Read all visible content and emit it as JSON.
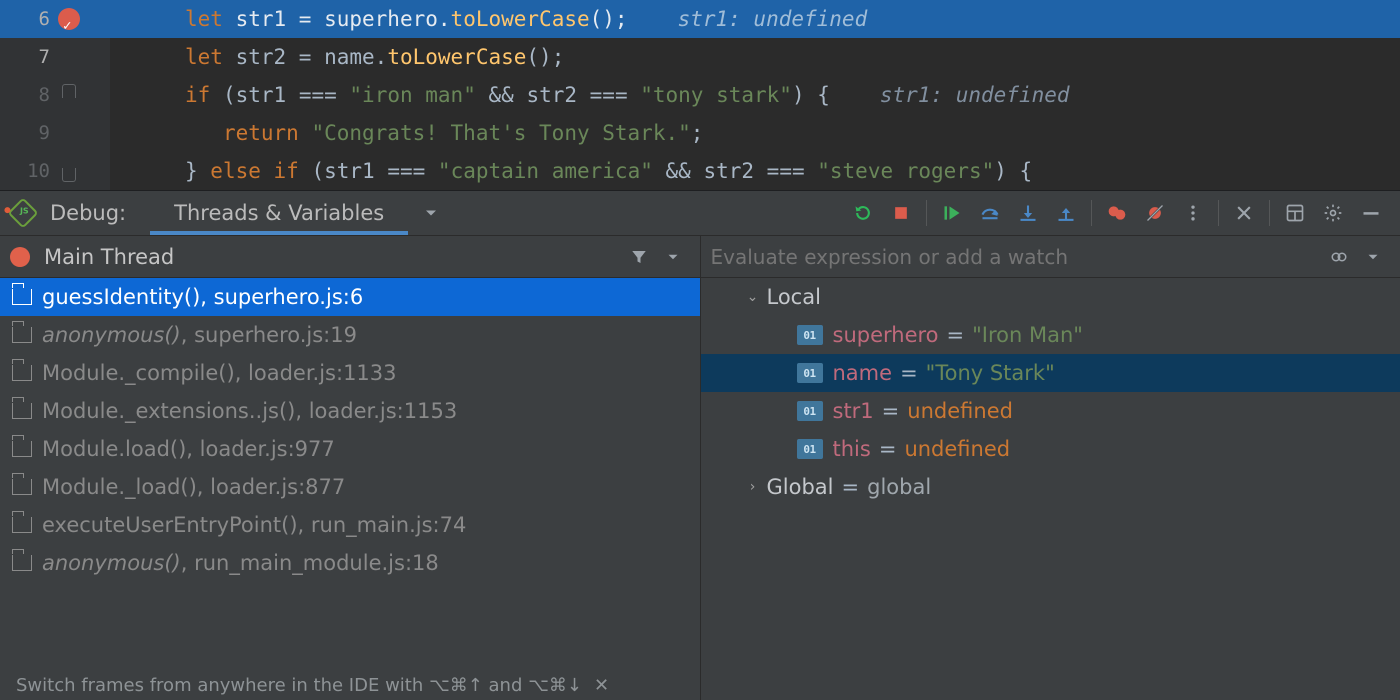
{
  "editor": {
    "lines": [
      {
        "num": 6,
        "breakpoint_hit": true,
        "current": true,
        "tokens": [
          [
            "kw",
            "let"
          ],
          [
            "",
            ""
          ],
          [
            "",
            " str1 "
          ],
          [
            "punct",
            "= "
          ],
          [
            "",
            "superhero"
          ],
          [
            "punct",
            "."
          ],
          [
            "fn",
            "toLowerCase"
          ],
          [
            "punct",
            "();"
          ]
        ],
        "hint": "str1: undefined"
      },
      {
        "num": 7,
        "current_num": true,
        "tokens": [
          [
            "kw",
            "let"
          ],
          [
            "",
            " str2 "
          ],
          [
            "punct",
            "= "
          ],
          [
            "",
            "name"
          ],
          [
            "punct",
            "."
          ],
          [
            "fn",
            "toLowerCase"
          ],
          [
            "punct",
            "();"
          ]
        ]
      },
      {
        "num": 8,
        "fold_top": true,
        "tokens": [
          [
            "kw",
            "if"
          ],
          [
            "",
            " "
          ],
          [
            "punct",
            "("
          ],
          [
            "",
            "str1 "
          ],
          [
            "punct",
            "=== "
          ],
          [
            "str",
            "\"iron man\""
          ],
          [
            "",
            " "
          ],
          [
            "punct",
            "&& "
          ],
          [
            "",
            "str2 "
          ],
          [
            "punct",
            "=== "
          ],
          [
            "str",
            "\"tony stark\""
          ],
          [
            "punct",
            ") {"
          ]
        ],
        "hint": "str1: undefined"
      },
      {
        "num": 9,
        "tokens": [
          [
            "",
            "   "
          ],
          [
            "kw",
            "return"
          ],
          [
            "",
            " "
          ],
          [
            "str",
            "\"Congrats! That's Tony Stark.\""
          ],
          [
            "punct",
            ";"
          ]
        ]
      },
      {
        "num": 10,
        "fold_bot": true,
        "tokens": [
          [
            "punct",
            "} "
          ],
          [
            "kw",
            "else if"
          ],
          [
            "",
            " "
          ],
          [
            "punct",
            "("
          ],
          [
            "",
            "str1 "
          ],
          [
            "punct",
            "=== "
          ],
          [
            "str",
            "\"captain america\""
          ],
          [
            "",
            " "
          ],
          [
            "punct",
            "&& "
          ],
          [
            "",
            "str2 "
          ],
          [
            "punct",
            "=== "
          ],
          [
            "str",
            "\"steve rogers\""
          ],
          [
            "punct",
            ") {"
          ]
        ]
      }
    ]
  },
  "debug_toolbar": {
    "label": "Debug:",
    "tab": "Threads & Variables"
  },
  "frames": {
    "title": "Main Thread",
    "items": [
      {
        "text": "guessIdentity(), superhero.js:6",
        "selected": true
      },
      {
        "text_italic": "anonymous()",
        "suffix": ", superhero.js:19"
      },
      {
        "text": "Module._compile(), loader.js:1133"
      },
      {
        "text": "Module._extensions..js(), loader.js:1153"
      },
      {
        "text": "Module.load(), loader.js:977"
      },
      {
        "text": "Module._load(), loader.js:877"
      },
      {
        "text": "executeUserEntryPoint(), run_main.js:74"
      },
      {
        "text_italic": "anonymous()",
        "suffix": ", run_main_module.js:18"
      }
    ]
  },
  "watches": {
    "placeholder": "Evaluate expression or add a watch",
    "scopes": [
      {
        "name": "Local",
        "expanded": true,
        "vars": [
          {
            "name": "superhero",
            "value": "\"Iron Man\"",
            "kind": "str"
          },
          {
            "name": "name",
            "value": "\"Tony Stark\"",
            "kind": "str",
            "selected": true
          },
          {
            "name": "str1",
            "value": "undefined",
            "kind": "undef"
          },
          {
            "name": "this",
            "value": "undefined",
            "kind": "undef"
          }
        ]
      },
      {
        "name": "Global",
        "expanded": false,
        "summary": "global"
      }
    ],
    "badge": "01"
  },
  "footer": {
    "text": "Switch frames from anywhere in the IDE with ⌥⌘↑ and ⌥⌘↓"
  }
}
